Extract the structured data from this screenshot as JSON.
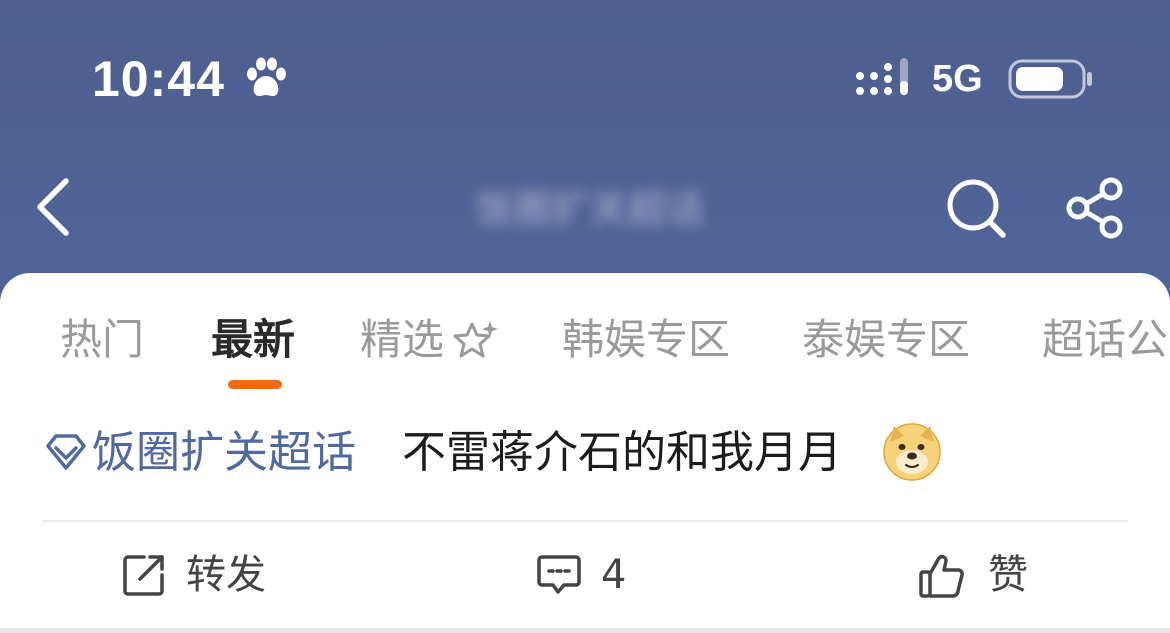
{
  "status_bar": {
    "time": "10:44",
    "network": "5G",
    "icons": [
      "paw-icon",
      "signal-icon",
      "battery-icon"
    ]
  },
  "nav": {
    "title": "饭圈扩关超话",
    "icons": [
      "chevron-left-icon",
      "search-icon",
      "share-icon"
    ]
  },
  "tabs": [
    {
      "label": "热门",
      "active": false
    },
    {
      "label": "最新",
      "active": true
    },
    {
      "label": "精选",
      "active": false
    },
    {
      "label": "韩娱专区",
      "active": false
    },
    {
      "label": "泰娱专区",
      "active": false
    },
    {
      "label": "超话公",
      "active": false
    }
  ],
  "post": {
    "topic": "饭圈扩关超话",
    "text": "不雷蒋介石的和我月月",
    "emoji": "doge-icon"
  },
  "actions": {
    "repost_label": "转发",
    "comment_count": "4",
    "like_label": "赞"
  },
  "colors": {
    "header_bg": "#4f6296",
    "accent": "#f36a17",
    "topic_link": "#4f6aa3",
    "tab_inactive": "#9a9a9a"
  }
}
